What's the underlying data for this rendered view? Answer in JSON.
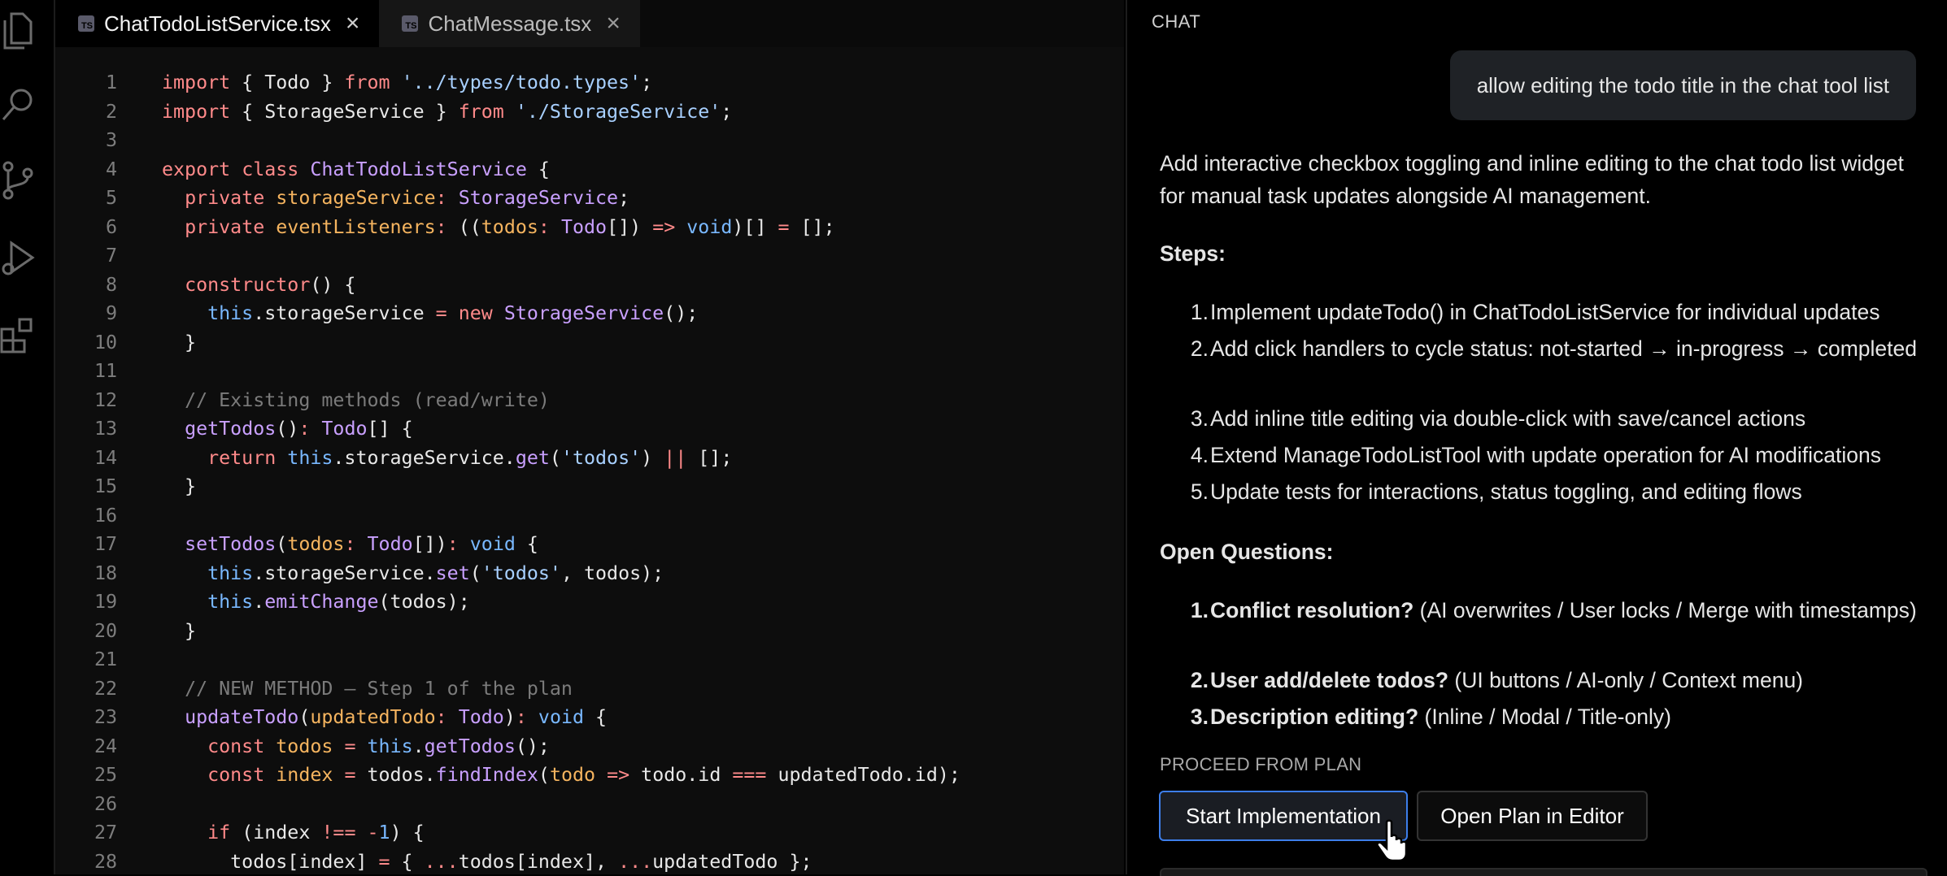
{
  "activity_bar": {
    "icons": [
      "files-icon",
      "search-icon",
      "source-control-icon",
      "run-debug-icon",
      "extensions-icon"
    ]
  },
  "editor": {
    "tabs": [
      {
        "label": "ChatTodoListService.tsx",
        "badge": "TS",
        "active": true
      },
      {
        "label": "ChatMessage.tsx",
        "badge": "TS",
        "active": false
      }
    ],
    "line_numbers": [
      "1",
      "2",
      "3",
      "4",
      "5",
      "6",
      "7",
      "8",
      "9",
      "10",
      "11",
      "12",
      "13",
      "14",
      "15",
      "16",
      "17",
      "18",
      "19",
      "20",
      "21",
      "22",
      "23",
      "24",
      "25",
      "26",
      "27",
      "28"
    ]
  },
  "chat": {
    "title": "CHAT",
    "user_message": "allow editing the todo title in the chat tool list",
    "summary": "Add interactive checkbox toggling and inline editing to the chat todo list widget for manual task updates alongside AI management.",
    "steps_heading": "Steps:",
    "steps": [
      {
        "num": "1.",
        "text": "Implement updateTodo() in ChatTodoListService for individual updates"
      },
      {
        "num": "2.",
        "text": "Add click handlers to cycle status: not-started → in-progress → completed"
      },
      {
        "num": "3.",
        "text": "Add inline title editing via double-click with save/cancel actions"
      },
      {
        "num": "4.",
        "text": "Extend ManageTodoListTool with update operation for AI modifications"
      },
      {
        "num": "5.",
        "text": "Update tests for interactions, status toggling, and editing flows"
      }
    ],
    "questions_heading": "Open Questions:",
    "questions": [
      {
        "num": "1.",
        "title": "Conflict resolution?",
        "text": " (AI overwrites / User locks / Merge with timestamps)"
      },
      {
        "num": "2.",
        "title": "User add/delete todos?",
        "text": " (UI buttons / AI-only / Context menu)"
      },
      {
        "num": "3.",
        "title": "Description editing?",
        "text": " (Inline / Modal / Title-only)"
      }
    ],
    "proceed_label": "PROCEED FROM PLAN",
    "start_button": "Start Implementation",
    "open_plan_button": "Open Plan in Editor"
  },
  "colors": {
    "accent": "#3d7eea",
    "keyword": "#ff8a8a",
    "string": "#a8d0ff",
    "type": "#c9a0ff",
    "param": "#f5b45f"
  }
}
